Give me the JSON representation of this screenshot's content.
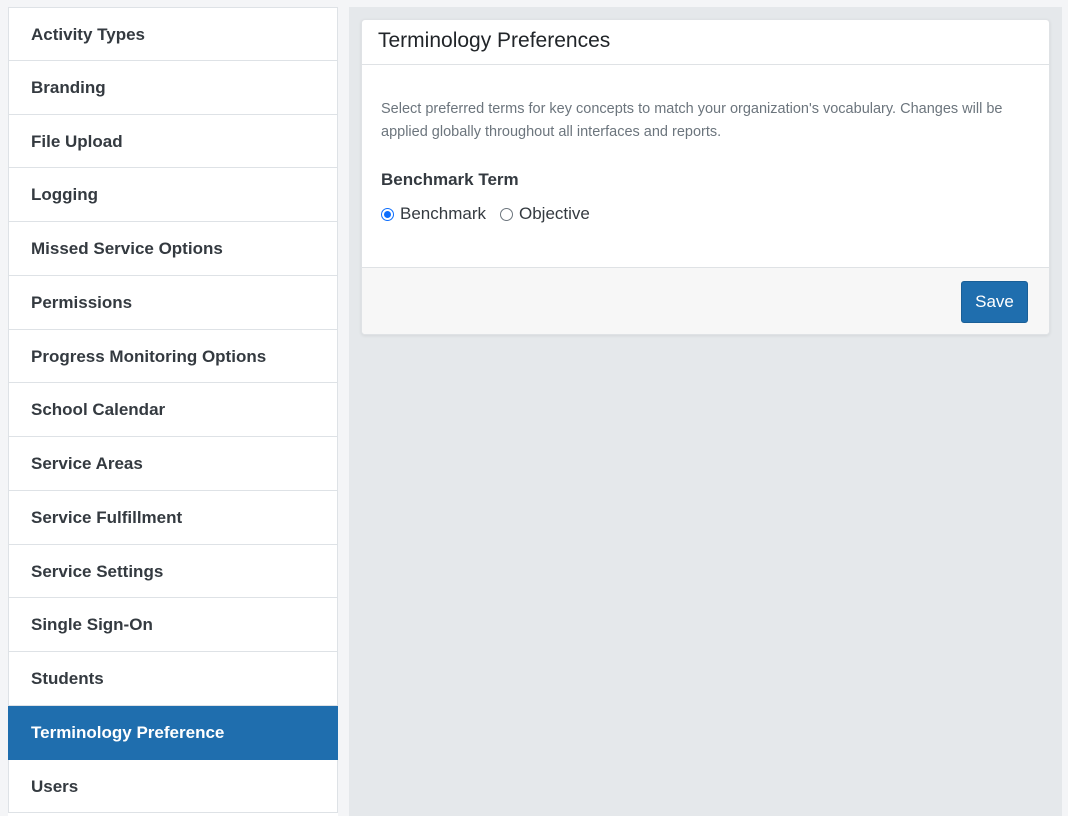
{
  "sidebar": {
    "items": [
      {
        "label": "Activity Types",
        "active": false
      },
      {
        "label": "Branding",
        "active": false
      },
      {
        "label": "File Upload",
        "active": false
      },
      {
        "label": "Logging",
        "active": false
      },
      {
        "label": "Missed Service Options",
        "active": false
      },
      {
        "label": "Permissions",
        "active": false
      },
      {
        "label": "Progress Monitoring Options",
        "active": false
      },
      {
        "label": "School Calendar",
        "active": false
      },
      {
        "label": "Service Areas",
        "active": false
      },
      {
        "label": "Service Fulfillment",
        "active": false
      },
      {
        "label": "Service Settings",
        "active": false
      },
      {
        "label": "Single Sign-On",
        "active": false
      },
      {
        "label": "Students",
        "active": false
      },
      {
        "label": "Terminology Preference",
        "active": true
      },
      {
        "label": "Users",
        "active": false
      }
    ]
  },
  "card": {
    "title": "Terminology Preferences",
    "description": "Select preferred terms for key concepts to match your organization's vocabulary. Changes will be applied globally throughout all interfaces and reports.",
    "field_label": "Benchmark Term",
    "options": [
      {
        "label": "Benchmark",
        "checked": true
      },
      {
        "label": "Objective",
        "checked": false
      }
    ],
    "save_label": "Save"
  },
  "colors": {
    "accent": "#1f6eae",
    "radio_checked": "#0d6efd",
    "main_background": "#e5e8eb"
  }
}
